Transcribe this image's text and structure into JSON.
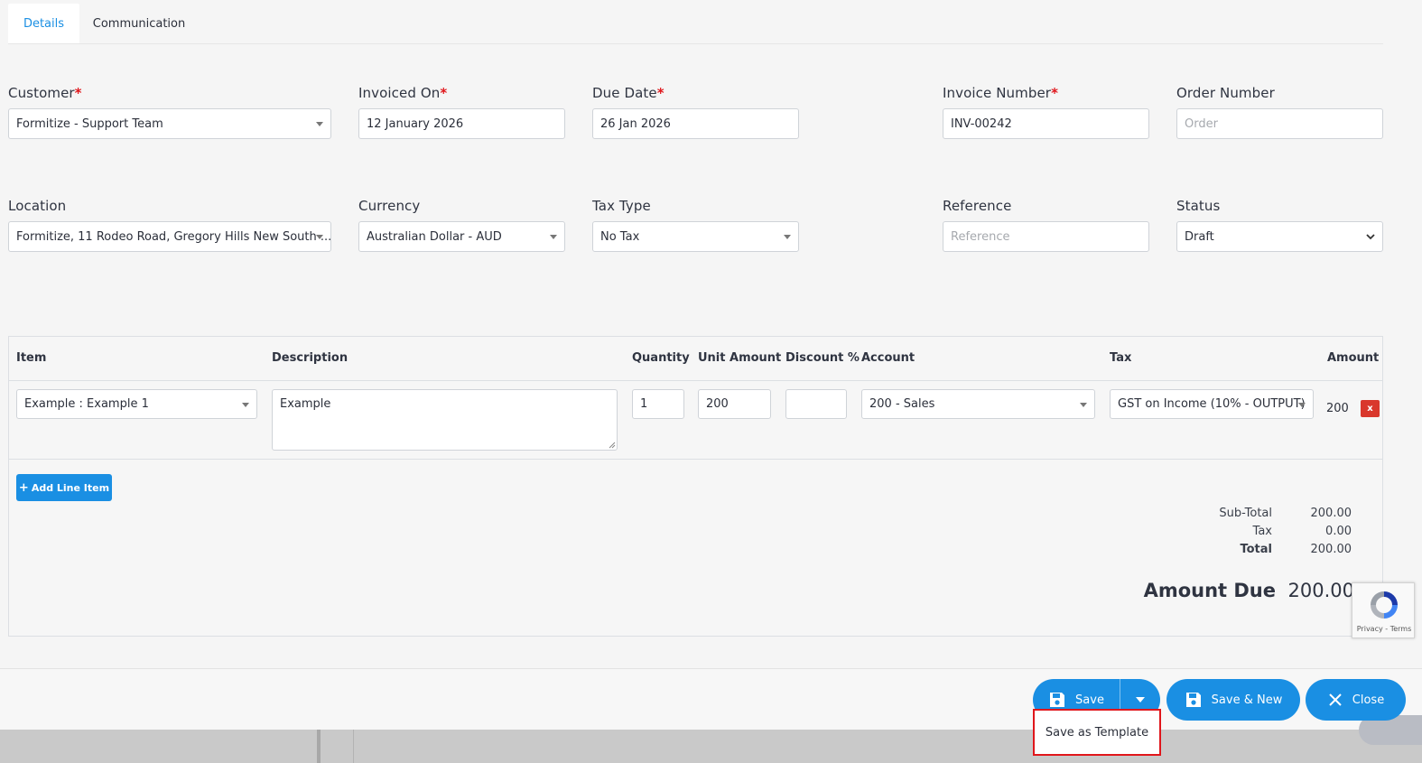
{
  "tabs": [
    {
      "label": "Details",
      "active": true
    },
    {
      "label": "Communication",
      "active": false
    }
  ],
  "form": {
    "customer": {
      "label": "Customer",
      "value": "Formitize - Support Team"
    },
    "invoiced_on": {
      "label": "Invoiced On",
      "value": "12 January 2026"
    },
    "due_date": {
      "label": "Due Date",
      "value": "26 Jan 2026"
    },
    "invoice_number": {
      "label": "Invoice Number",
      "value": "INV-00242"
    },
    "order_number": {
      "label": "Order Number",
      "placeholder": "Order"
    },
    "location": {
      "label": "Location",
      "value": "Formitize, 11 Rodeo Road, Gregory Hills New South ..."
    },
    "currency": {
      "label": "Currency",
      "value": "Australian Dollar - AUD"
    },
    "tax_type": {
      "label": "Tax Type",
      "value": "No Tax"
    },
    "reference": {
      "label": "Reference",
      "placeholder": "Reference"
    },
    "status": {
      "label": "Status",
      "value": "Draft"
    },
    "required_mark": "*"
  },
  "table": {
    "headers": {
      "item": "Item",
      "description": "Description",
      "quantity": "Quantity",
      "unit_amount": "Unit Amount",
      "discount": "Discount %",
      "account": "Account",
      "tax": "Tax",
      "amount": "Amount"
    },
    "rows": [
      {
        "item": "Example : Example 1",
        "description": "Example",
        "quantity": "1",
        "unit_amount": "200",
        "discount": "",
        "account": "200 - Sales",
        "tax": "GST on Income (10% - OUTPUT)",
        "amount": "200",
        "delete": "x"
      }
    ],
    "add_line_label": "Add Line Item",
    "add_line_icon": "+"
  },
  "totals": {
    "subtotal_label": "Sub-Total",
    "subtotal_value": "200.00",
    "tax_label": "Tax",
    "tax_value": "0.00",
    "total_label": "Total",
    "total_value": "200.00",
    "amount_due_label": "Amount Due",
    "amount_due_value": "200.00"
  },
  "recaptcha": {
    "terms": "Privacy - Terms"
  },
  "footer": {
    "save_label": "Save",
    "save_new_label": "Save & New",
    "close_label": "Close",
    "dropdown_item": "Save as Template"
  },
  "colors": {
    "accent": "#1a8fe3",
    "required": "#e0161b",
    "delete": "#d9372c"
  }
}
